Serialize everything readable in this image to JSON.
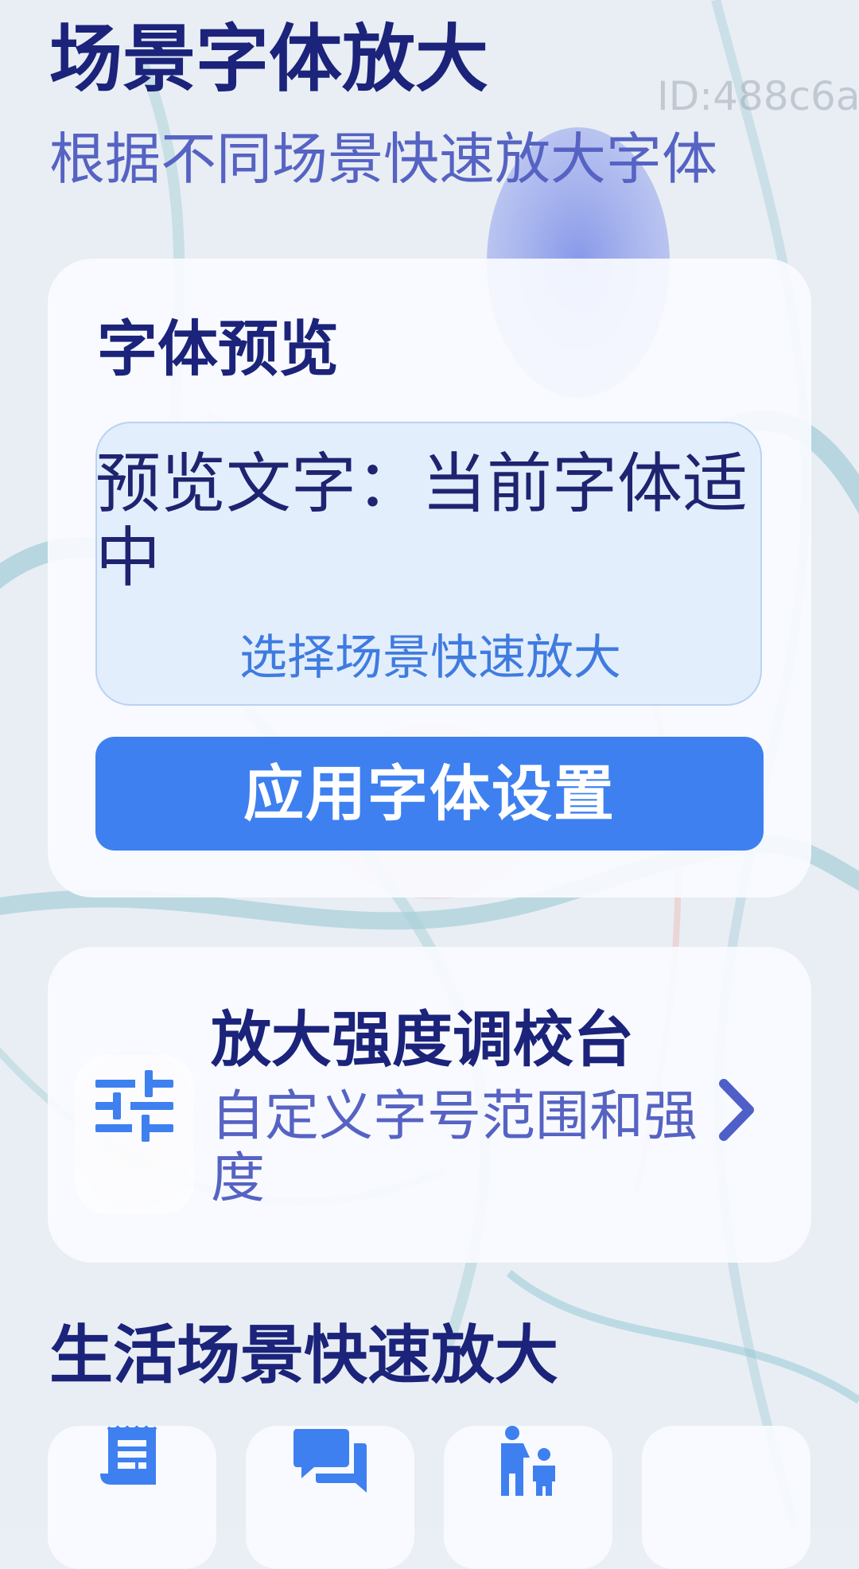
{
  "watermark": "ID:488c6a",
  "header": {
    "title": "场景字体放大",
    "subtitle": "根据不同场景快速放大字体"
  },
  "preview": {
    "title": "字体预览",
    "sample_text": "预览文字：当前字体适中",
    "hint": "选择场景快速放大",
    "apply_label": "应用字体设置"
  },
  "tuning": {
    "title": "放大强度调校台",
    "description": "自定义字号范围和强度",
    "icon": "sliders-icon",
    "chevron": "chevron-right-icon"
  },
  "scenes": {
    "title": "生活场景快速放大",
    "items": [
      {
        "icon": "receipt-icon"
      },
      {
        "icon": "chat-icon"
      },
      {
        "icon": "family-icon"
      },
      {
        "icon": ""
      }
    ]
  },
  "colors": {
    "primary": "#3e80f0",
    "title": "#1b237a",
    "subtitle": "#5663c3",
    "background": "#e9eff5"
  }
}
